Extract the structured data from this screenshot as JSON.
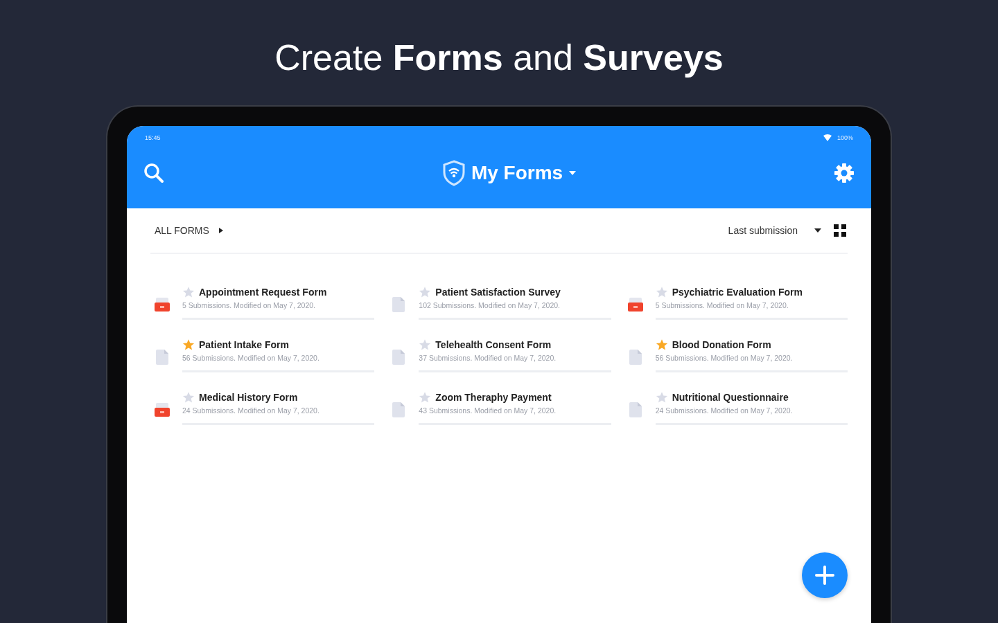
{
  "headline": "Create **Forms** and **Surveys**",
  "status_bar": {
    "time": "15:45",
    "battery": "100%"
  },
  "header": {
    "title": "My Forms"
  },
  "toolbar": {
    "filter": "ALL FORMS",
    "sort": "Last submission"
  },
  "forms": [
    {
      "title": "Appointment Request Form",
      "subtitle": "5 Submissions. Modified on May 7, 2020.",
      "starred": false,
      "kind": "inbox"
    },
    {
      "title": "Patient Satisfaction Survey",
      "subtitle": "102 Submissions. Modified on May 7, 2020.",
      "starred": false,
      "kind": "document"
    },
    {
      "title": "Psychiatric Evaluation Form",
      "subtitle": "5 Submissions. Modified on May 7, 2020.",
      "starred": false,
      "kind": "inbox"
    },
    {
      "title": "Patient Intake Form",
      "subtitle": "56 Submissions. Modified on May 7, 2020.",
      "starred": true,
      "kind": "document"
    },
    {
      "title": "Telehealth Consent Form",
      "subtitle": "37 Submissions. Modified on May 7, 2020.",
      "starred": false,
      "kind": "document"
    },
    {
      "title": "Blood Donation Form",
      "subtitle": "56 Submissions. Modified on May 7, 2020.",
      "starred": true,
      "kind": "document"
    },
    {
      "title": "Medical History Form",
      "subtitle": "24 Submissions. Modified on May 7, 2020.",
      "starred": false,
      "kind": "inbox"
    },
    {
      "title": "Zoom Theraphy Payment",
      "subtitle": "43 Submissions. Modified on May 7, 2020.",
      "starred": false,
      "kind": "document"
    },
    {
      "title": "Nutritional Questionnaire",
      "subtitle": "24 Submissions. Modified on May 7, 2020.",
      "starred": false,
      "kind": "document"
    }
  ]
}
